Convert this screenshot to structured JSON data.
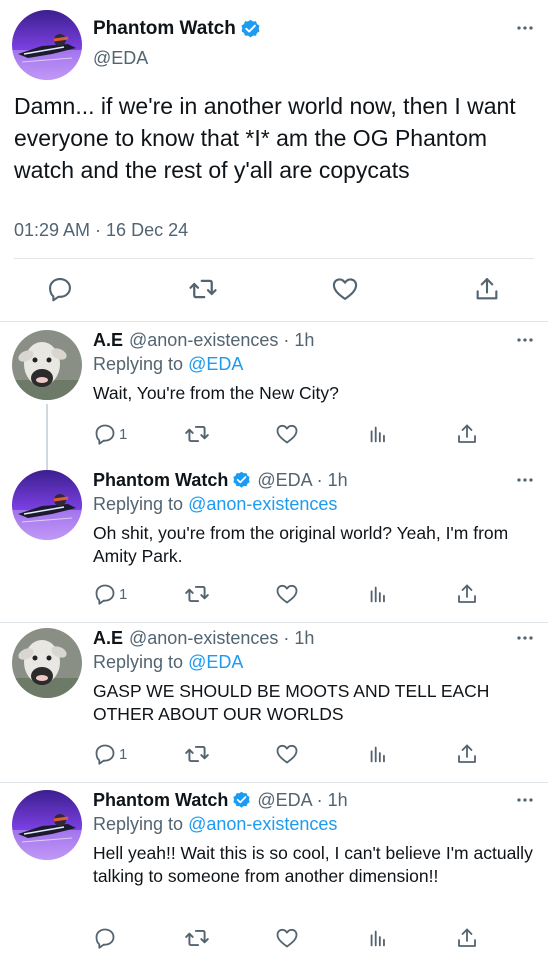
{
  "colors": {
    "accent": "#1d9bf0",
    "icon_gray": "#536471",
    "verified_blue": "#1d9bf0"
  },
  "main_tweet": {
    "name": "Phantom Watch",
    "handle": "@EDA",
    "verified": true,
    "text": "Damn... if we're in another world now, then I want everyone to know that *I* am the OG Phantom watch and the rest of y'all are copycats",
    "timestamp": "01:29 AM · 16 Dec 24",
    "more_icon": "more-dots-icon",
    "actions": [
      "reply-icon",
      "retweet-icon",
      "like-icon",
      "share-icon"
    ]
  },
  "replies": [
    {
      "name": "A.E",
      "verified": false,
      "meta": "@anon-existences · 1h",
      "replying_prefix": "Replying to",
      "replying_to": "@EDA",
      "text": "Wait, You're from the New City?",
      "reply_count": "1",
      "avatar": "goat"
    },
    {
      "name": "Phantom Watch",
      "verified": true,
      "meta": "@EDA · 1h",
      "replying_prefix": "Replying to",
      "replying_to": "@anon-existences",
      "text": "Oh shit, you're from the original world? Yeah, I'm from Amity Park.",
      "reply_count": "1",
      "avatar": "phantom"
    },
    {
      "name": "A.E",
      "verified": false,
      "meta": "@anon-existences · 1h",
      "replying_prefix": "Replying to",
      "replying_to": "@EDA",
      "text": "GASP WE SHOULD BE MOOTS AND TELL EACH OTHER ABOUT OUR WORLDS",
      "reply_count": "1",
      "avatar": "goat"
    },
    {
      "name": "Phantom Watch",
      "verified": true,
      "meta": "@EDA · 1h",
      "replying_prefix": "Replying to",
      "replying_to": "@anon-existences",
      "text": "Hell yeah!! Wait this is so cool, I can't believe I'm actually talking to someone from another dimension!!",
      "reply_count": "",
      "avatar": "phantom"
    }
  ]
}
